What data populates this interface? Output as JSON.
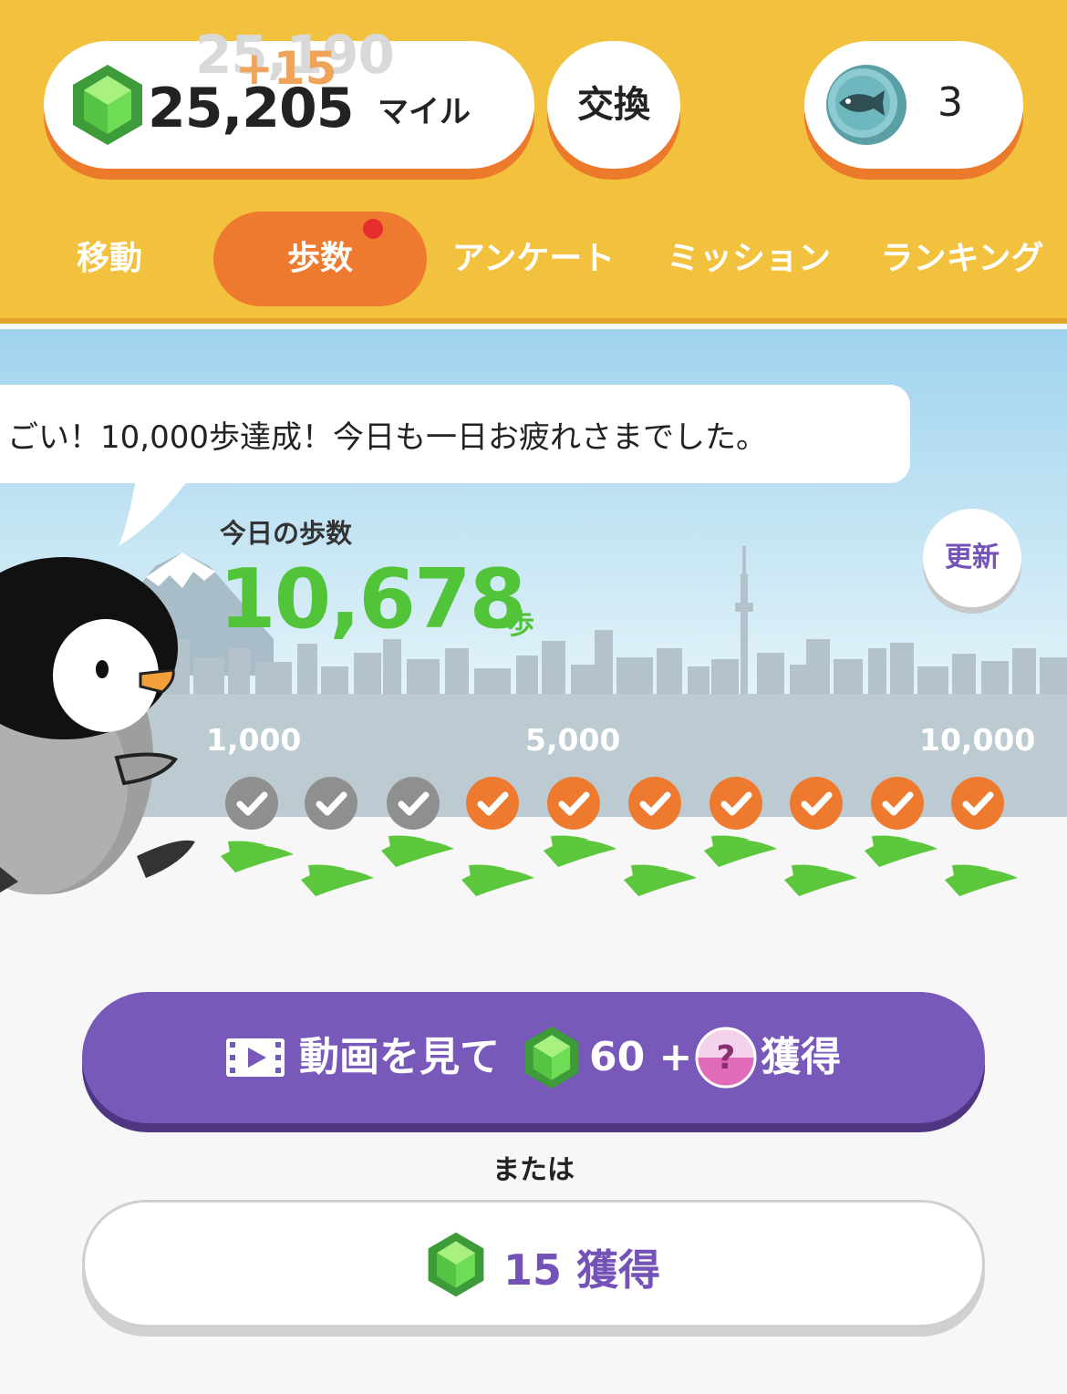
{
  "header": {
    "miles_previous": "25,190",
    "miles_gain": "+15",
    "miles_value": "25,205",
    "miles_unit": "マイル",
    "exchange_label": "交換",
    "fish_coin_count": "3",
    "gem_icon": "green-gem-icon",
    "fish_icon": "fish-coin-icon"
  },
  "tabs": [
    {
      "label": "移動",
      "active": false
    },
    {
      "label": "歩数",
      "active": true,
      "badge": true
    },
    {
      "label": "アンケート",
      "active": false
    },
    {
      "label": "ミッション",
      "active": false
    },
    {
      "label": "ランキング",
      "active": false
    }
  ],
  "speech_bubble": "ごい！10,000歩達成！今日も一日お疲れさまでした。",
  "steps": {
    "label": "今日の歩数",
    "value": "10,678",
    "unit": "歩",
    "refresh_label": "更新"
  },
  "milestones": {
    "labels": [
      "1,000",
      "5,000",
      "10,000"
    ],
    "checks": [
      "gray",
      "gray",
      "gray",
      "orange",
      "orange",
      "orange",
      "orange",
      "orange",
      "orange",
      "orange"
    ]
  },
  "video_button": {
    "text": "動画を見て",
    "amount": "60 +",
    "suffix": "獲得",
    "icons": [
      "film-icon",
      "green-gem-icon",
      "mystery-ball-icon"
    ]
  },
  "or_text": "または",
  "claim_button": {
    "label": "15 獲得",
    "icon": "green-gem-icon"
  },
  "colors": {
    "header_bg": "#f2c23e",
    "accent_orange": "#ee7a30",
    "steps_green": "#52c43a",
    "button_purple": "#7858b9"
  }
}
